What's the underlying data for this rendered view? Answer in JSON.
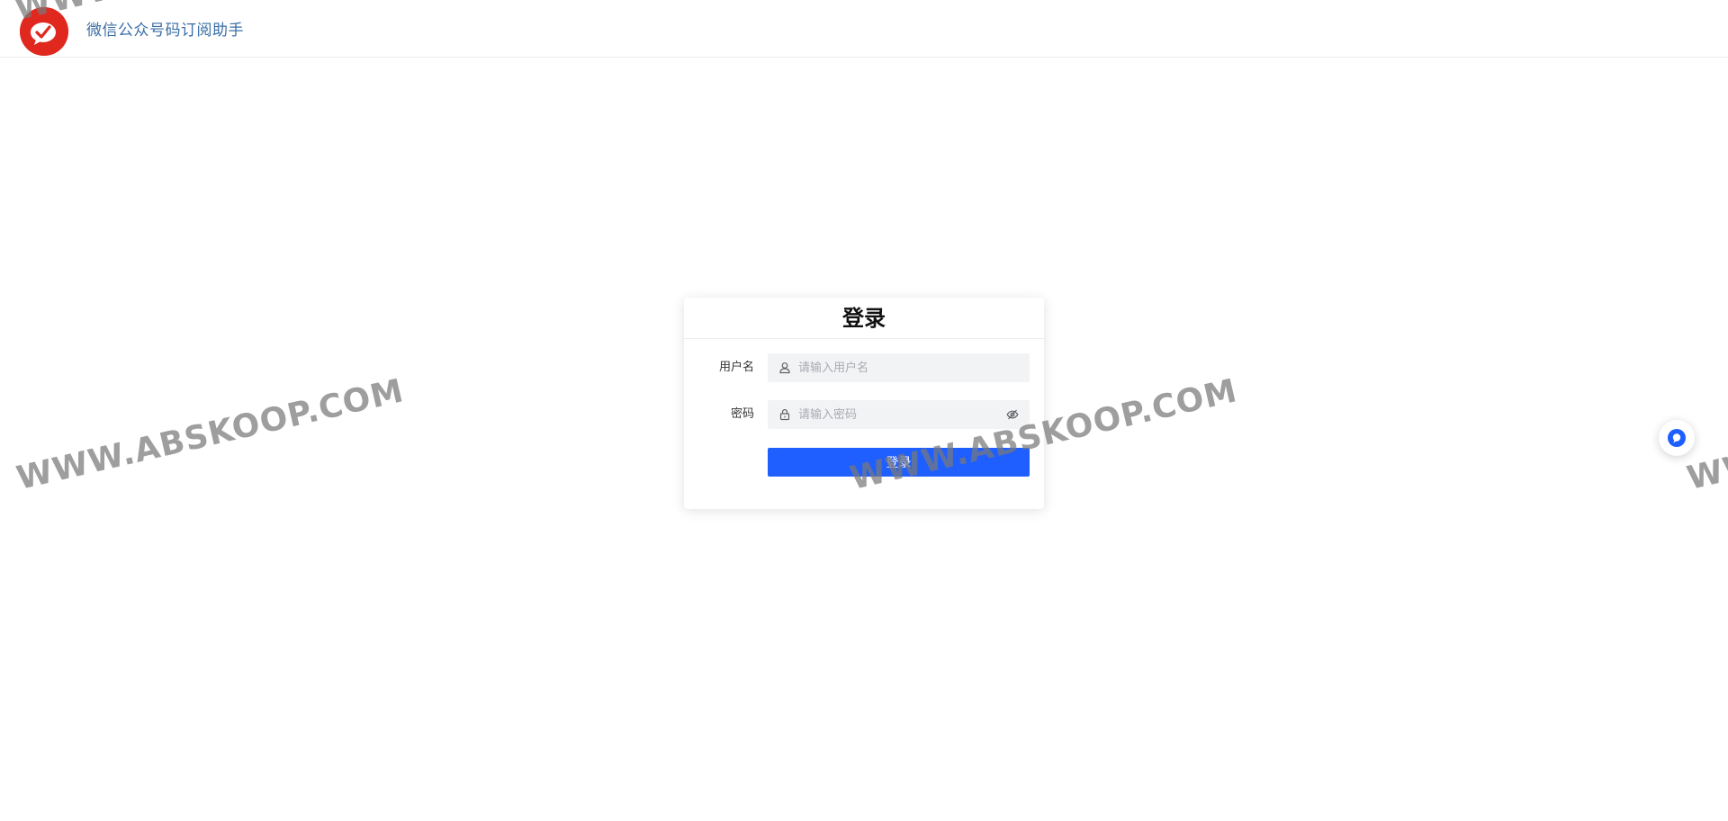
{
  "header": {
    "logo_icon": "wechat-subscribe-logo-icon",
    "title": "微信公众号码订阅助手"
  },
  "login": {
    "title": "登录",
    "username_label": "用户名",
    "username_placeholder": "请输入用户名",
    "username_icon": "user-icon",
    "password_label": "密码",
    "password_placeholder": "请输入密码",
    "password_icon": "lock-icon",
    "toggle_icon": "eye-off-icon",
    "submit_label": "登录"
  },
  "float_button": {
    "icon": "chat-bubble-icon"
  },
  "watermark": {
    "text": "WWW.ABSKOOP.COM"
  },
  "colors": {
    "logo": "#e0281e",
    "title": "#3a6ea5",
    "primary": "#1f5eff",
    "input_bg": "#f2f3f5"
  }
}
